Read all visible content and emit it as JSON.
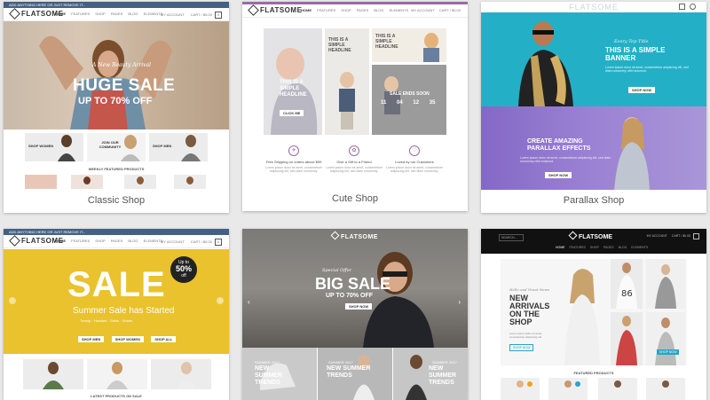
{
  "cards": {
    "classic": {
      "caption": "Classic Shop",
      "topbar": "ADD ANYTHING HERE OR JUST REMOVE IT...",
      "logo": "FLATSOME",
      "nav": [
        "HOME",
        "FEATURES",
        "SHOP",
        "PAGES",
        "BLOG",
        "ELEMENTS"
      ],
      "account": "MY ACCOUNT",
      "cart_label": "CART / $0.00",
      "cart_count": "0",
      "hero_script": "A New Beauty Arrival",
      "hero_title": "HUGE SALE",
      "hero_sub": "UP TO 70% OFF",
      "tiles": [
        "SHOP WOMEN",
        "JOIN OUR COMMUNITY",
        "SHOP MEN"
      ],
      "section": "WEEKLY FEATURED PRODUCTS"
    },
    "cute": {
      "caption": "Cute Shop",
      "logo": "FLATSOME",
      "nav": [
        "HOME",
        "FEATURES",
        "SHOP",
        "PAGES",
        "BLOG",
        "ELEMENTS"
      ],
      "account": "MY ACCOUNT",
      "cart_label": "CART / $0.00",
      "headline": "THIS IS A SIMPLE HEADLINE",
      "btn": "CLICK ME",
      "sale_ends": "SALE ENDS SOON",
      "countdown": [
        "11",
        "04",
        "12",
        "35"
      ],
      "features": [
        "Free Shipping on orders above $99",
        "Give a Gift to a Friend",
        "Loved by our Customers"
      ],
      "feature_text": "Lorem ipsum dolor sit amet, consectetuer adipiscing elit, sed diam nonummy."
    },
    "parallax": {
      "caption": "Parallax Shop",
      "logo": "FLATSOME",
      "script": "Every Top Title",
      "banner_title": "THIS IS A SIMPLE BANNER",
      "banner_text": "Lorem ipsum dolor sit amet, consectetuer adipiscing elit, sed diam nonummy nibh euismod.",
      "btn1": "SHOP NOW",
      "banner2_title": "CREATE AMAZING PARALLAX EFFECTS",
      "banner2_text": "Lorem ipsum dolor sit amet, consectetuer adipiscing elit, sed diam nonummy nibh euismod.",
      "btn2": "SHOP NOW"
    },
    "sale": {
      "topbar": "ADD ANYTHING HERE OR JUST REMOVE IT...",
      "logo": "FLATSOME",
      "nav": [
        "HOME",
        "FEATURES",
        "SHOP",
        "PAGES",
        "BLOG",
        "ELEMENTS"
      ],
      "account": "MY ACCOUNT",
      "cart_label": "CART / $0.00",
      "cart_count": "0",
      "hero_title": "SALE",
      "badge_top": "Up to",
      "badge_pct": "50%",
      "badge_off": "off",
      "hero_sub": "Summer Sale has Started",
      "hero_small": "Trendy · Hoodies · Shirts · Shoes",
      "btns": [
        "SHOP MEN",
        "SHOP WOMEN",
        "SHOP ALL"
      ],
      "section": "LATEST PRODUCTS ON SALE"
    },
    "bigsale": {
      "logo": "FLATSOME",
      "script": "Special Offer",
      "hero_title": "BIG SALE",
      "hero_sub": "UP TO 70% OFF",
      "btn": "SHOP NOW",
      "tiles": [
        {
          "top": "SUMMER 2017",
          "title": "NEW SUMMER TRENDS"
        },
        {
          "top": "SUMMER 2017",
          "title": "NEW SUMMER TRENDS"
        },
        {
          "top": "SUMMER 2017",
          "title": "NEW SUMMER TRENDS"
        }
      ]
    },
    "dark": {
      "search": "SEARCH...",
      "logo": "FLATSOME",
      "account": "MY ACCOUNT",
      "cart_label": "CART / $0.00",
      "nav": [
        "HOME",
        "FEATURES",
        "SHOP",
        "PAGES",
        "BLOG",
        "ELEMENTS"
      ],
      "script": "Hello and Great News",
      "hero_title": "NEW ARRIVALS ON THE SHOP",
      "hero_text": "Lorem ipsum dolor sit amet, consectetuer adipiscing elit.",
      "btn1": "SHOP NOW",
      "btn2": "SHOP NOW",
      "section": "FEATURED PRODUCTS"
    }
  }
}
